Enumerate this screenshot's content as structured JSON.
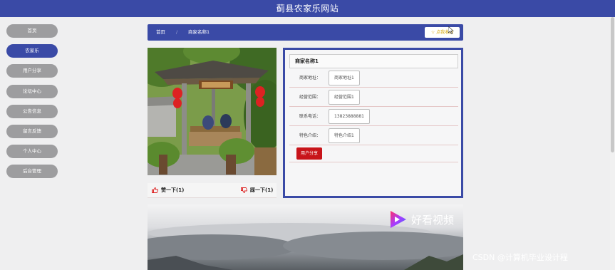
{
  "header": {
    "title": "蓟县农家乐网站"
  },
  "sidebar": {
    "items": [
      {
        "label": "首页"
      },
      {
        "label": "农家乐"
      },
      {
        "label": "用户分享"
      },
      {
        "label": "论坛中心"
      },
      {
        "label": "公告信息"
      },
      {
        "label": "留言反馈"
      },
      {
        "label": "个人中心"
      },
      {
        "label": "后台管理"
      }
    ],
    "active_index": 1
  },
  "breadcrumb": {
    "home": "首页",
    "separator": "/",
    "current": "商家名称1",
    "favorite_label": "☆ 点我收藏"
  },
  "votes": {
    "up": "赞一下(1)",
    "down": "踩一下(1)"
  },
  "detail": {
    "name": "商家名称1",
    "fields": [
      {
        "label": "商家地址：",
        "value": "商家地址1"
      },
      {
        "label": "经营范围：",
        "value": "经营范围1"
      },
      {
        "label": "联系电话：",
        "value": "13823888881"
      },
      {
        "label": "特色介绍：",
        "value": "特色介绍1"
      }
    ],
    "share_button": "用户分享"
  },
  "video": {
    "logo_text": "好看视频"
  },
  "watermark": "CSDN @计算机毕业设计程",
  "colors": {
    "primary": "#3a4aa6",
    "sidebar_inactive": "#9d9d9f",
    "accent_red": "#c8141a",
    "favorite_gold": "#d4a300"
  }
}
